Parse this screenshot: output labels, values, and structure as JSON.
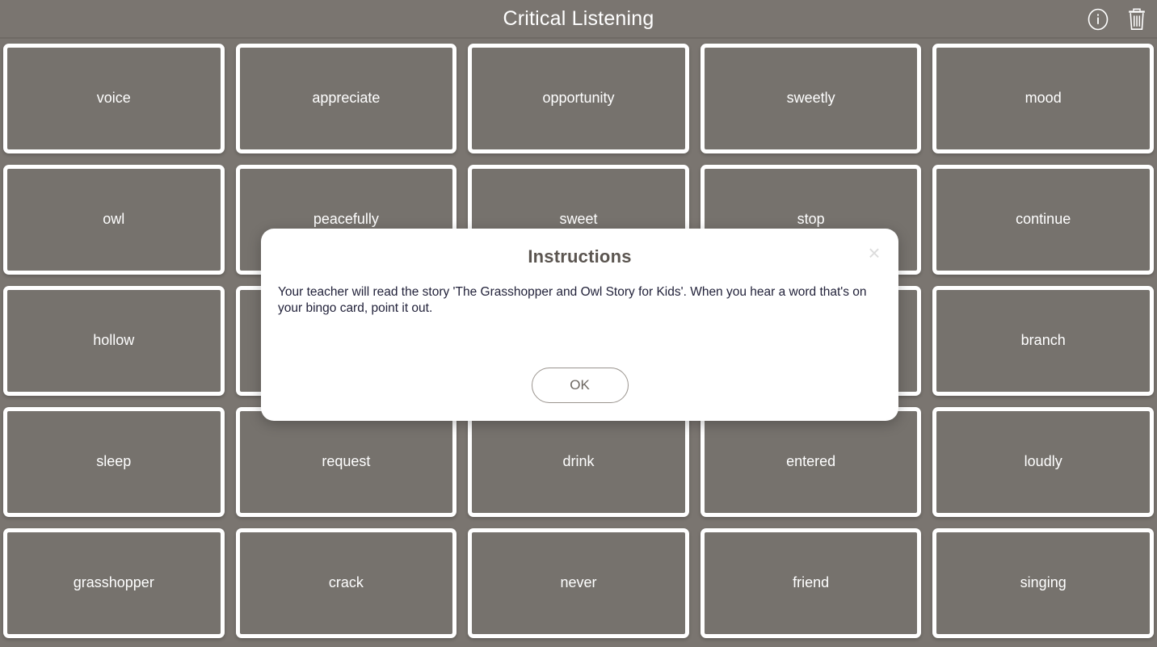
{
  "header": {
    "title": "Critical Listening",
    "info_icon": "info-circle-icon",
    "delete_icon": "trash-icon"
  },
  "bingo": {
    "rows": 5,
    "columns": 5,
    "cards": [
      {
        "label": "voice"
      },
      {
        "label": "appreciate"
      },
      {
        "label": "opportunity"
      },
      {
        "label": "sweetly"
      },
      {
        "label": "mood"
      },
      {
        "label": "owl"
      },
      {
        "label": "peacefully"
      },
      {
        "label": "sweet"
      },
      {
        "label": "stop"
      },
      {
        "label": "continue"
      },
      {
        "label": "hollow"
      },
      {
        "label": ""
      },
      {
        "label": ""
      },
      {
        "label": ""
      },
      {
        "label": "branch"
      },
      {
        "label": "sleep"
      },
      {
        "label": "request"
      },
      {
        "label": "drink"
      },
      {
        "label": "entered"
      },
      {
        "label": "loudly"
      },
      {
        "label": "grasshopper"
      },
      {
        "label": "crack"
      },
      {
        "label": "never"
      },
      {
        "label": "friend"
      },
      {
        "label": "singing"
      }
    ]
  },
  "modal": {
    "title": "Instructions",
    "body": "Your teacher will read the story 'The Grasshopper and Owl Story for Kids'. When you hear a word that's on your bingo card, point it out.",
    "ok_label": "OK",
    "close_label": "×"
  },
  "colors": {
    "page_background": "#7a7570",
    "card_fill": "#76726d",
    "card_border": "#ffffff",
    "card_text": "#ffffff",
    "header_text": "#ffffff",
    "modal_background": "#ffffff",
    "modal_title_text": "#5b5550",
    "modal_body_text": "#22223a",
    "ok_button_text": "#6d6760"
  }
}
